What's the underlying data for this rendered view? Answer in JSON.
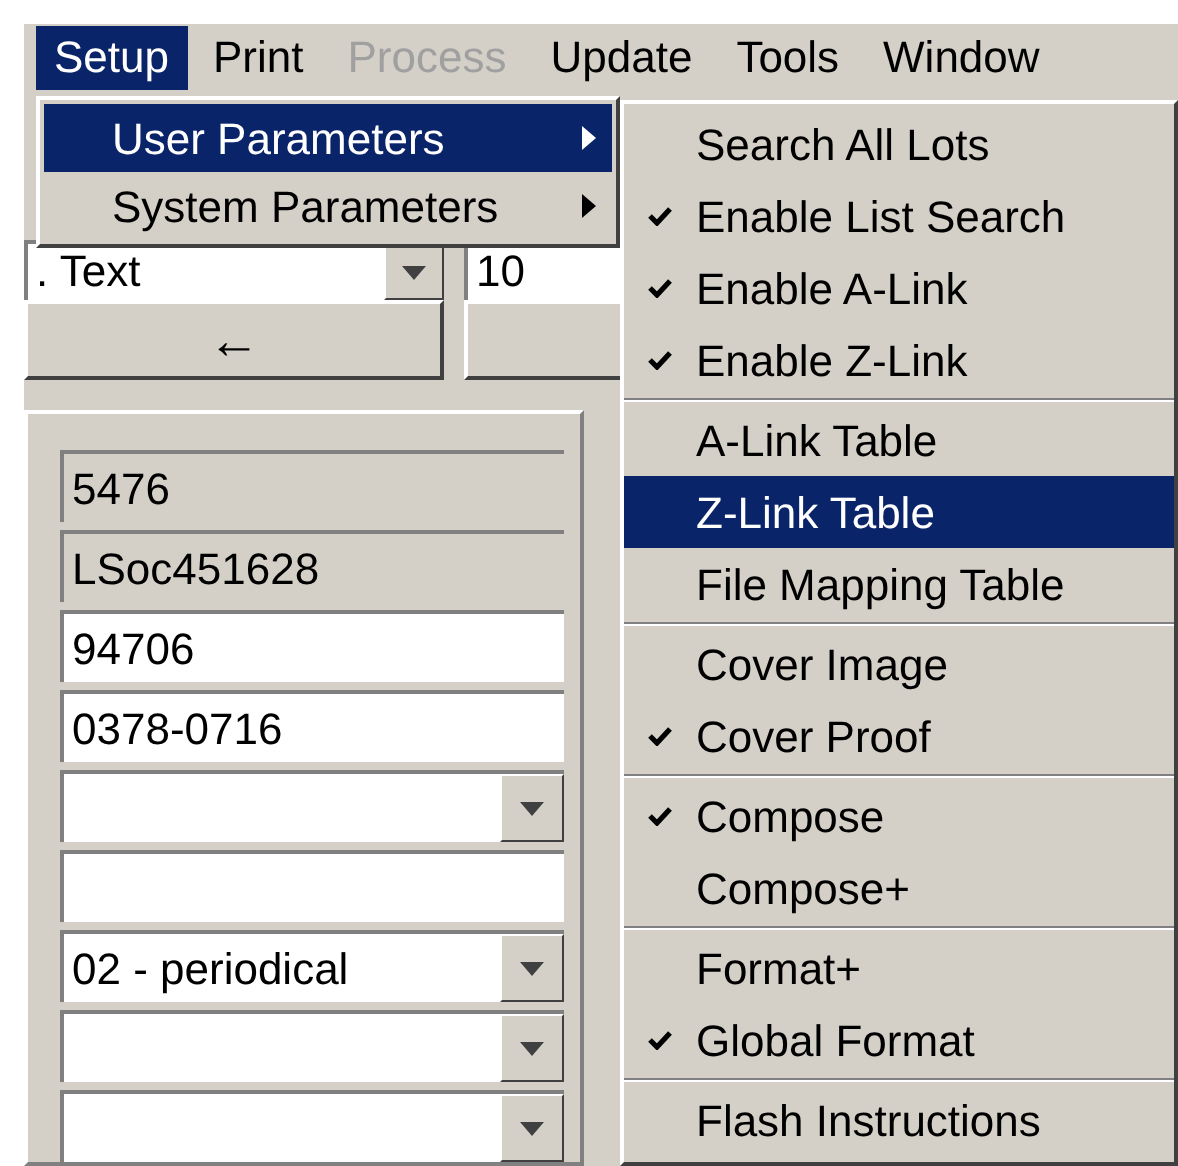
{
  "menubar": [
    {
      "label": "Setup",
      "selected": true,
      "disabled": false
    },
    {
      "label": "Print",
      "selected": false,
      "disabled": false
    },
    {
      "label": "Process",
      "selected": false,
      "disabled": true
    },
    {
      "label": "Update",
      "selected": false,
      "disabled": false
    },
    {
      "label": "Tools",
      "selected": false,
      "disabled": false
    },
    {
      "label": "Window",
      "selected": false,
      "disabled": false
    }
  ],
  "setup_menu": [
    {
      "label": "User Parameters",
      "selected": true
    },
    {
      "label": "System Parameters",
      "selected": false
    }
  ],
  "user_parameters_menu": [
    {
      "items": [
        {
          "label": "Search All Lots",
          "checked": false,
          "selected": false
        },
        {
          "label": "Enable List Search",
          "checked": true,
          "selected": false
        },
        {
          "label": "Enable A-Link",
          "checked": true,
          "selected": false
        },
        {
          "label": "Enable Z-Link",
          "checked": true,
          "selected": false
        }
      ]
    },
    {
      "items": [
        {
          "label": "A-Link Table",
          "checked": false,
          "selected": false
        },
        {
          "label": "Z-Link Table",
          "checked": false,
          "selected": true
        },
        {
          "label": "File Mapping Table",
          "checked": false,
          "selected": false
        }
      ]
    },
    {
      "items": [
        {
          "label": "Cover Image",
          "checked": false,
          "selected": false
        },
        {
          "label": "Cover Proof",
          "checked": true,
          "selected": false
        }
      ]
    },
    {
      "items": [
        {
          "label": "Compose",
          "checked": true,
          "selected": false
        },
        {
          "label": "Compose+",
          "checked": false,
          "selected": false
        }
      ]
    },
    {
      "items": [
        {
          "label": "Format+",
          "checked": false,
          "selected": false
        },
        {
          "label": "Global Format",
          "checked": true,
          "selected": false
        }
      ]
    },
    {
      "items": [
        {
          "label": "Flash Instructions",
          "checked": false,
          "selected": false
        }
      ]
    }
  ],
  "form": {
    "font_combo": {
      "value": ". Text"
    },
    "size_field": {
      "value": "10"
    },
    "back_button": {
      "label": "←"
    },
    "fields": [
      {
        "kind": "readonly",
        "value": "5476"
      },
      {
        "kind": "readonly",
        "value": "LSoc451628"
      },
      {
        "kind": "text",
        "value": "94706"
      },
      {
        "kind": "text",
        "value": "0378-0716"
      },
      {
        "kind": "combo"
      },
      {
        "kind": "text"
      },
      {
        "kind": "combo",
        "value": "02 - periodical"
      },
      {
        "kind": "combo"
      },
      {
        "kind": "combo"
      }
    ]
  }
}
